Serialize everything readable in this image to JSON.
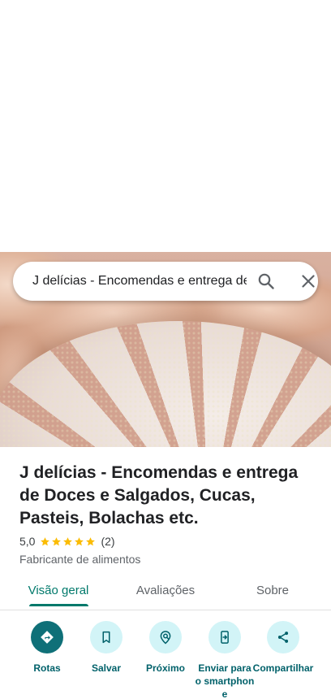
{
  "search": {
    "query": "J delícias - Encomendas e entrega de Doces e Salgados, Cucas, Pasteis, Bolachas etc."
  },
  "place": {
    "title": "J delícias - Encomendas e entrega de Doces e Salgados, Cucas, Pasteis, Bolachas etc.",
    "rating": "5,0",
    "stars": 5,
    "review_count": "(2)",
    "category": "Fabricante de alimentos"
  },
  "tabs": [
    {
      "label": "Visão geral",
      "active": true
    },
    {
      "label": "Avaliações",
      "active": false
    },
    {
      "label": "Sobre",
      "active": false
    }
  ],
  "actions": [
    {
      "label": "Rotas",
      "icon": "directions-icon"
    },
    {
      "label": "Salvar",
      "icon": "bookmark-icon"
    },
    {
      "label": "Próximo",
      "icon": "nearby-icon"
    },
    {
      "label": "Enviar para o smartphone",
      "icon": "send-to-phone-icon"
    },
    {
      "label": "Compartilhar",
      "icon": "share-icon"
    }
  ],
  "colors": {
    "accent": "#00796b",
    "primary_action": "#0f7078",
    "action_bg": "#d2f4f7",
    "star": "#fbbc04"
  }
}
